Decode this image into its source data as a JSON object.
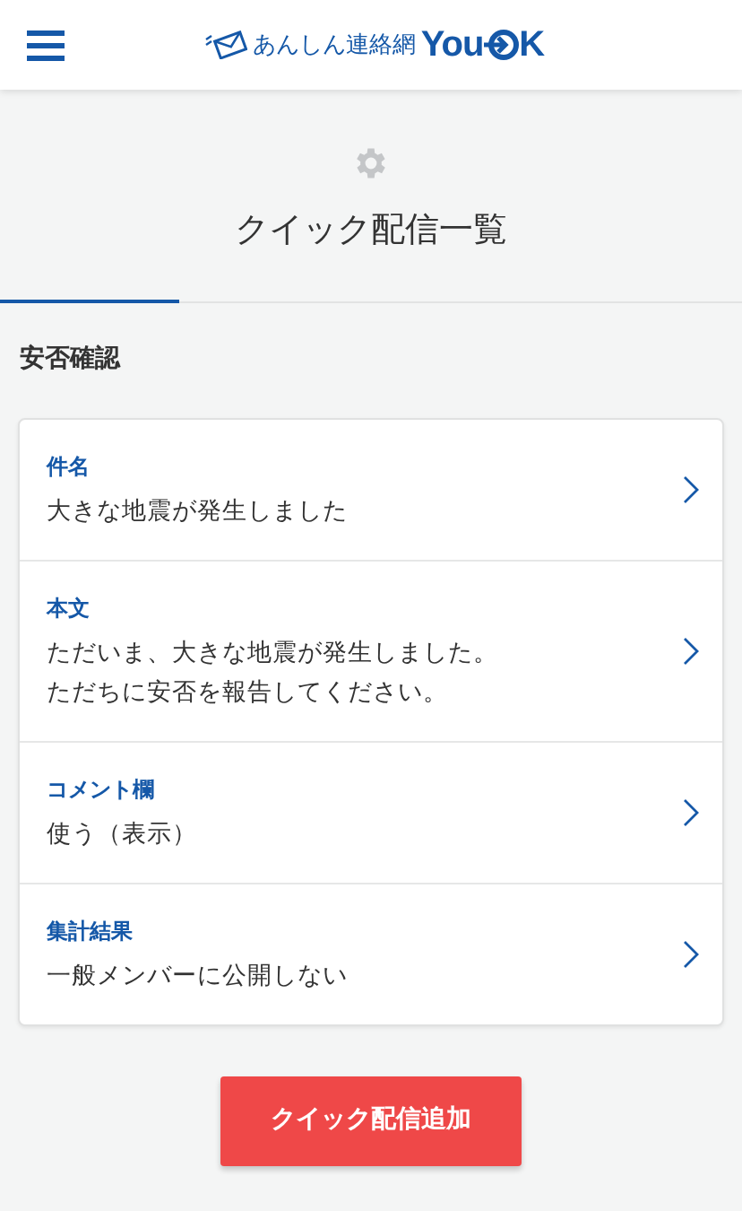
{
  "header": {
    "logo": {
      "tagline": "あんしん連絡網",
      "brand_start": "You",
      "brand_end": "K"
    }
  },
  "page": {
    "title": "クイック配信一覧"
  },
  "section": {
    "title": "安否確認"
  },
  "items": [
    {
      "label": "件名",
      "lines": [
        "大きな地震が発生しました"
      ]
    },
    {
      "label": "本文",
      "lines": [
        "ただいま、大きな地震が発生しました。",
        "ただちに安否を報告してください。"
      ]
    },
    {
      "label": "コメント欄",
      "lines": [
        "使う（表示）"
      ]
    },
    {
      "label": "集計結果",
      "lines": [
        "一般メンバーに公開しない"
      ]
    }
  ],
  "button": {
    "label": "クイック配信追加"
  }
}
